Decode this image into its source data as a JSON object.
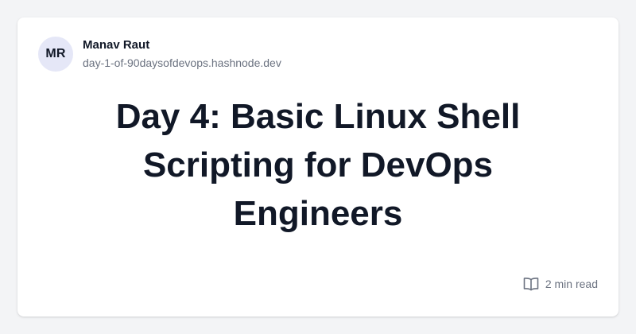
{
  "author": {
    "initials": "MR",
    "name": "Manav Raut",
    "domain": "day-1-of-90daysofdevops.hashnode.dev"
  },
  "post": {
    "title": "Day 4: Basic Linux Shell Scripting for DevOps Engineers",
    "read_time": "2 min read"
  },
  "icons": {
    "read_time_icon": "book-open-icon"
  },
  "colors": {
    "background": "#f3f4f6",
    "card": "#ffffff",
    "avatar_bg": "#e5e7f7",
    "text_primary": "#111827",
    "text_secondary": "#6b7280"
  }
}
